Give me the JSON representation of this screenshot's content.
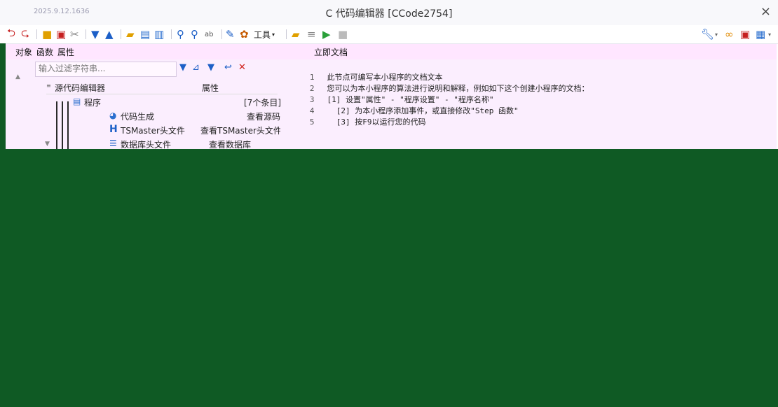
{
  "window": {
    "timestamp": "2025.9.12.1636",
    "title": "C 代码编辑器 [CCode2754]",
    "close_glyph": "×"
  },
  "toolbar": {
    "tools_label": "工具",
    "icons": [
      "undo-icon",
      "redo-icon",
      "copy-icon",
      "paste-icon",
      "cut-icon",
      "move-down-icon",
      "move-up-icon",
      "open-folder-icon",
      "save-icon",
      "save-as-icon",
      "find-icon",
      "find-next-icon",
      "replace-icon",
      "brush-icon",
      "settings-icon",
      "folder-icon",
      "clear-icon",
      "run-icon",
      "stop-icon",
      "wrench-icon",
      "link-icon",
      "delete-window-icon",
      "layout-icon"
    ]
  },
  "tabs": {
    "objects": "对象",
    "functions": "函数",
    "properties": "属性",
    "instant_doc": "立即文档"
  },
  "left_panel": {
    "filter_placeholder": "输入过滤字符串...",
    "tree_header": {
      "name": "源代码编辑器",
      "value": "属性"
    },
    "rows": [
      {
        "name": "程序",
        "value": "[7个条目]"
      },
      {
        "name": "代码生成",
        "value": "查看源码"
      },
      {
        "name": "TSMaster头文件",
        "value": "查看TSMaster头文件"
      },
      {
        "name": "数据库头文件",
        "value": "查看数据库"
      }
    ]
  },
  "editor": {
    "lines": [
      {
        "num": "1",
        "text": "此节点可编写本小程序的文档文本"
      },
      {
        "num": "2",
        "text": "您可以为本小程序的算法进行说明和解释，例如如下这个创建小程序的文档："
      },
      {
        "num": "3",
        "text": "[1] 设置\"属性\" - \"程序设置\" - \"程序名称\""
      },
      {
        "num": "4",
        "text": "  [2] 为本小程序添加事件，或直接修改\"Step 函数\""
      },
      {
        "num": "5",
        "text": "  [3] 按F9以运行您的代码"
      }
    ]
  },
  "colors": {
    "panel_bg": "#fbeefe",
    "tab_bg": "#ffe6ff",
    "green_area": "#0f5a24",
    "accent_blue": "#1c5fc7",
    "accent_red": "#d0221c"
  }
}
